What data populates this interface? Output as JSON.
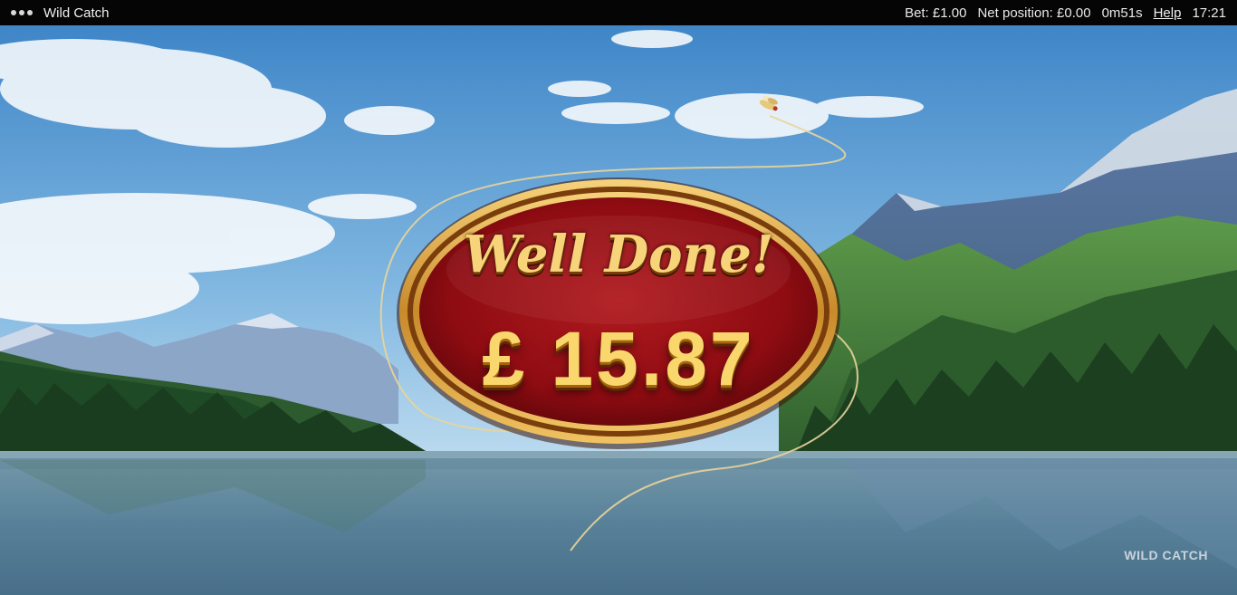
{
  "topbar": {
    "game_title": "Wild Catch",
    "bet": "Bet: £1.00",
    "net_position": "Net position: £0.00",
    "session_time": "0m51s",
    "help": "Help",
    "clock": "17:21"
  },
  "win_panel": {
    "heading": "Well Done!",
    "amount": "£ 15.87"
  },
  "watermark": "WILD CATCH",
  "colors": {
    "plaque_red": "#8e0c12",
    "plaque_gold": "#d9a13a",
    "text_gold": "#f9d76c",
    "topbar_bg": "#050505"
  },
  "icons": [
    "menu-dots-icon",
    "fishing-fly-icon"
  ]
}
